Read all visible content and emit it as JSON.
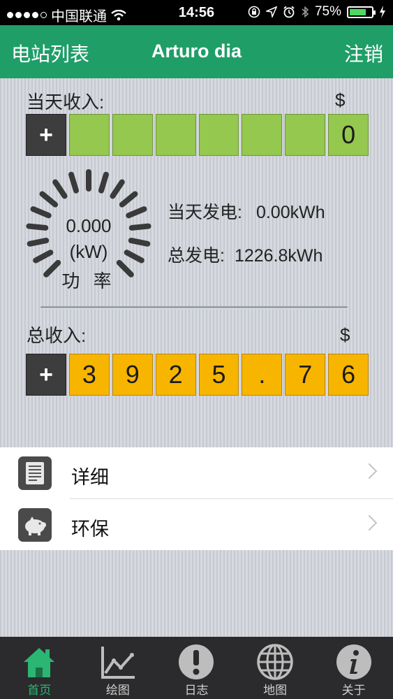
{
  "status_bar": {
    "carrier": "中国联通",
    "time": "14:56",
    "battery_percent": "75%",
    "battery_level": 0.75,
    "icons": [
      "signal-dots-icon",
      "wifi-icon",
      "orientation-lock-icon",
      "location-icon",
      "alarm-icon",
      "bluetooth-icon",
      "battery-icon",
      "charging-icon"
    ]
  },
  "nav": {
    "left_label": "电站列表",
    "title": "Arturo dia",
    "right_label": "注销"
  },
  "today_income": {
    "label": "当天收入:",
    "currency": "$",
    "plus": "+",
    "digits": [
      "",
      "",
      "",
      "",
      "",
      "",
      "0"
    ]
  },
  "power": {
    "value": "0.000",
    "unit": "(kW)",
    "label": "功 率"
  },
  "stats": {
    "today_generation_label": "当天发电:",
    "today_generation_value": "0.00kWh",
    "total_generation_label": "总发电:",
    "total_generation_value": "1226.8kWh"
  },
  "total_income": {
    "label": "总收入:",
    "currency": "$",
    "plus": "+",
    "digits": [
      "3",
      "9",
      "2",
      "5",
      ".",
      "7",
      "6"
    ]
  },
  "menu": [
    {
      "label": "详细",
      "icon": "document-icon"
    },
    {
      "label": "环保",
      "icon": "piggy-bank-icon"
    }
  ],
  "tabs": [
    {
      "label": "首页",
      "icon": "home-icon",
      "active": true
    },
    {
      "label": "绘图",
      "icon": "chart-icon",
      "active": false
    },
    {
      "label": "日志",
      "icon": "alert-icon",
      "active": false
    },
    {
      "label": "地图",
      "icon": "globe-icon",
      "active": false
    },
    {
      "label": "关于",
      "icon": "info-icon",
      "active": false
    }
  ],
  "colors": {
    "nav_green": "#1f9e68",
    "today_cell_green": "#94c84e",
    "total_cell_orange": "#f7b500",
    "tab_active": "#2bb673"
  }
}
